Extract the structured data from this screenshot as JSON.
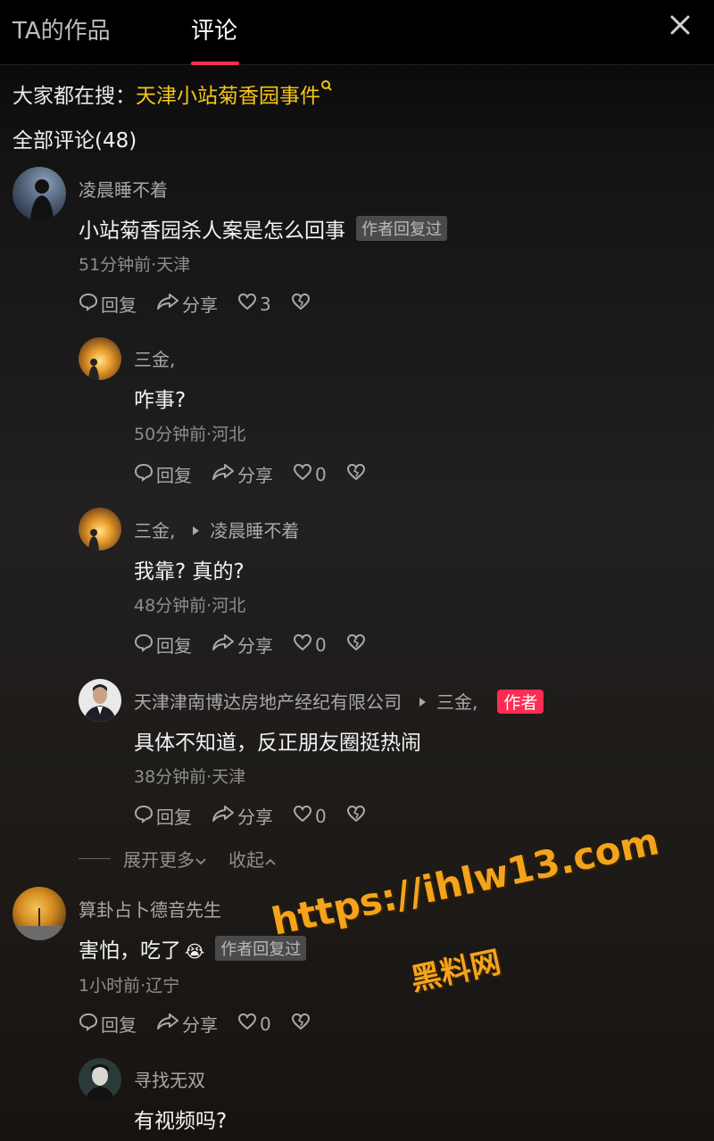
{
  "header": {
    "tabs": [
      {
        "label": "TA的作品",
        "active": false
      },
      {
        "label": "评论",
        "active": true
      }
    ],
    "close_icon": "close-icon",
    "accent_color": "#fe2c55"
  },
  "hot_search": {
    "prefix": "大家都在搜：",
    "keyword": "天津小站菊香园事件",
    "keyword_color": "#f5c518"
  },
  "comments_count": "全部评论(48)",
  "comments": [
    {
      "user": "凌晨睡不着",
      "text": "小站菊香园杀人案是怎么回事",
      "badge": "作者回复过",
      "meta": "51分钟前·天津",
      "actions": {
        "reply": "回复",
        "share": "分享",
        "likes": "3"
      },
      "replies": [
        {
          "user": "三金,",
          "text": "咋事?",
          "meta": "50分钟前·河北",
          "actions": {
            "reply": "回复",
            "share": "分享",
            "likes": "0"
          }
        },
        {
          "user": "三金,",
          "reply_to": "凌晨睡不着",
          "text": "我靠? 真的?",
          "meta": "48分钟前·河北",
          "actions": {
            "reply": "回复",
            "share": "分享",
            "likes": "0"
          }
        },
        {
          "user": "天津津南博达房地产经纪有限公司",
          "reply_to": "三金,",
          "author_tag": "作者",
          "text": "具体不知道，反正朋友圈挺热闹",
          "meta": "38分钟前·天津",
          "actions": {
            "reply": "回复",
            "share": "分享",
            "likes": "0"
          }
        }
      ],
      "expand_more": "展开更多",
      "collapse": "收起"
    },
    {
      "user": "算卦占卜德音先生",
      "text": "害怕，吃了",
      "emoji": "😭",
      "badge": "作者回复过",
      "meta": "1小时前·辽宁",
      "actions": {
        "reply": "回复",
        "share": "分享",
        "likes": "0"
      },
      "replies": [
        {
          "user": "寻找无双",
          "text": "有视频吗?"
        }
      ]
    }
  ],
  "watermark": {
    "url": "https://ihlw13.com",
    "name": "黑料网",
    "color": "#f4a31c"
  }
}
